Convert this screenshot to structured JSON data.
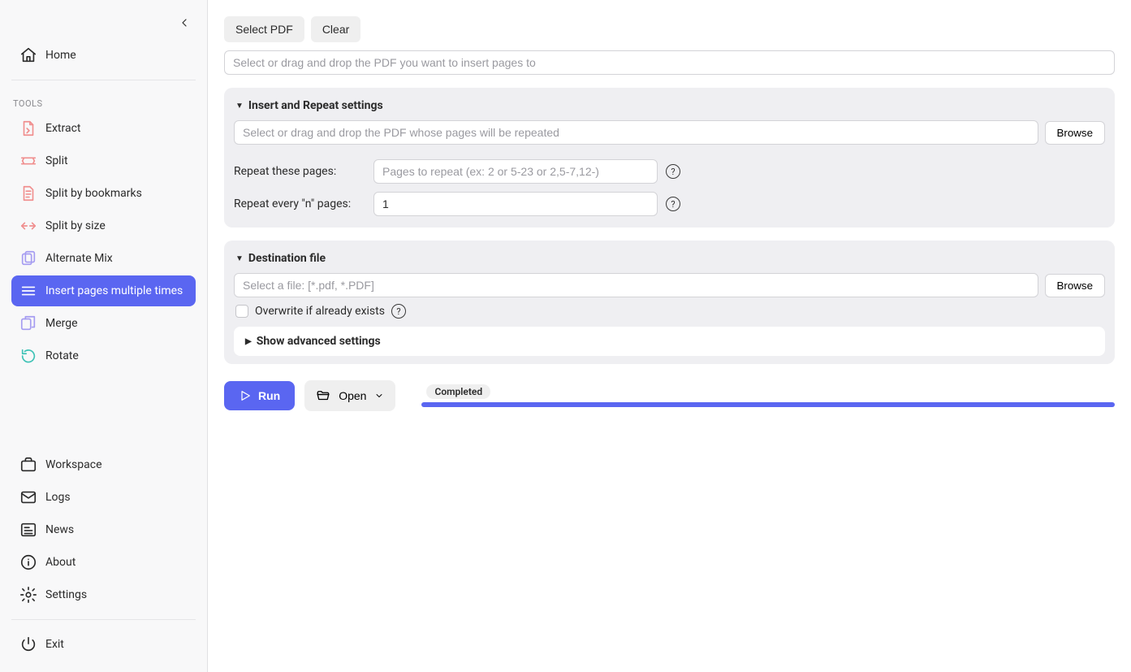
{
  "sidebar": {
    "home": "Home",
    "tools_label": "TOOLS",
    "tools": [
      {
        "id": "extract",
        "label": "Extract"
      },
      {
        "id": "split",
        "label": "Split"
      },
      {
        "id": "split-bookmarks",
        "label": "Split by bookmarks"
      },
      {
        "id": "split-size",
        "label": "Split by size"
      },
      {
        "id": "alternate-mix",
        "label": "Alternate Mix"
      },
      {
        "id": "insert-multiple",
        "label": "Insert pages multiple times"
      },
      {
        "id": "merge",
        "label": "Merge"
      },
      {
        "id": "rotate",
        "label": "Rotate"
      }
    ],
    "footer": {
      "workspace": "Workspace",
      "logs": "Logs",
      "news": "News",
      "about": "About",
      "settings": "Settings",
      "exit": "Exit"
    }
  },
  "toolbar": {
    "select_pdf": "Select PDF",
    "clear": "Clear"
  },
  "main": {
    "target_placeholder": "Select or drag and drop the PDF you want to insert pages to",
    "insert_panel": {
      "title": "Insert and Repeat settings",
      "source_placeholder": "Select or drag and drop the PDF whose pages will be repeated",
      "browse": "Browse",
      "repeat_pages_label": "Repeat these pages:",
      "repeat_pages_placeholder": "Pages to repeat (ex: 2 or 5-23 or 2,5-7,12-)",
      "repeat_every_label": "Repeat every \"n\" pages:",
      "repeat_every_value": "1"
    },
    "dest_panel": {
      "title": "Destination file",
      "placeholder": "Select a file: [*.pdf, *.PDF]",
      "browse": "Browse",
      "overwrite_label": "Overwrite if already exists",
      "advanced_label": "Show advanced settings"
    }
  },
  "run": {
    "run_label": "Run",
    "open_label": "Open",
    "status": "Completed"
  }
}
